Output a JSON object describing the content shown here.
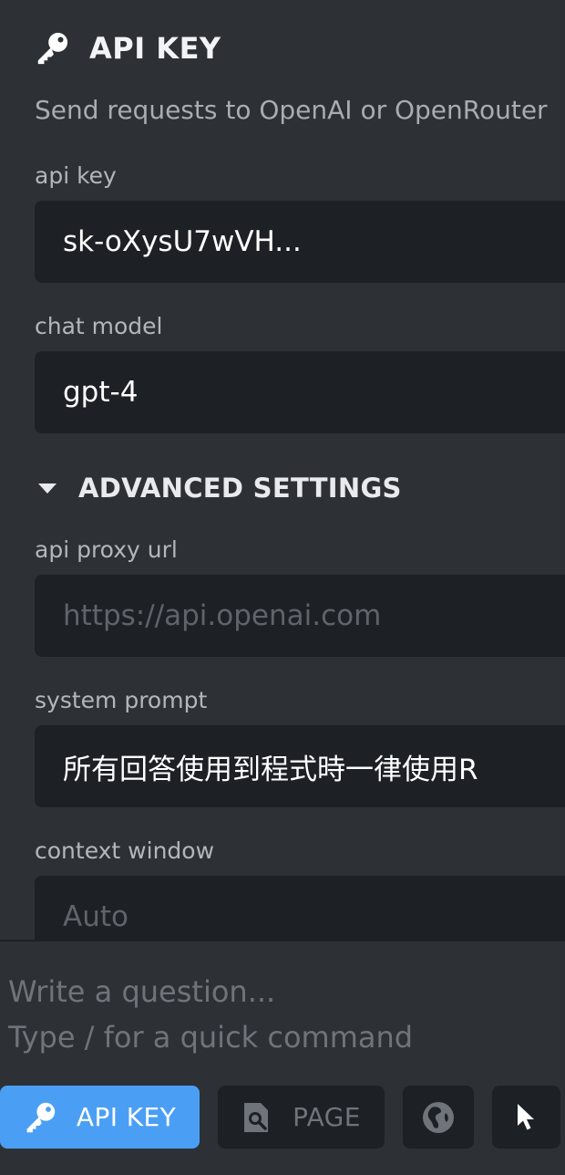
{
  "api_section": {
    "title": "API KEY",
    "description": "Send requests to OpenAI or OpenRouter",
    "api_key_label": "api key",
    "api_key_value": "sk-oXysU7wVH...",
    "chat_model_label": "chat model",
    "chat_model_value": "gpt-4"
  },
  "advanced": {
    "title": "ADVANCED SETTINGS",
    "api_proxy_label": "api proxy url",
    "api_proxy_placeholder": "https://api.openai.com",
    "system_prompt_label": "system prompt",
    "system_prompt_value": "所有回答使用到程式時一律使用R",
    "context_window_label": "context window",
    "context_window_placeholder": "Auto"
  },
  "composer": {
    "placeholder_line1": "Write a question...",
    "placeholder_line2": "Type / for a quick command"
  },
  "toolbar": {
    "api_key_label": "API KEY",
    "page_label": "PAGE"
  },
  "icons": {
    "section": "key-icon",
    "advanced": "caret-down-icon",
    "api_key_button": "key-icon",
    "page_button": "page-search-icon",
    "web_button": "globe-icon",
    "select_button": "cursor-icon"
  },
  "colors": {
    "background": "#2d3136",
    "field_background": "#1d2025",
    "accent": "#4a9ff5"
  }
}
